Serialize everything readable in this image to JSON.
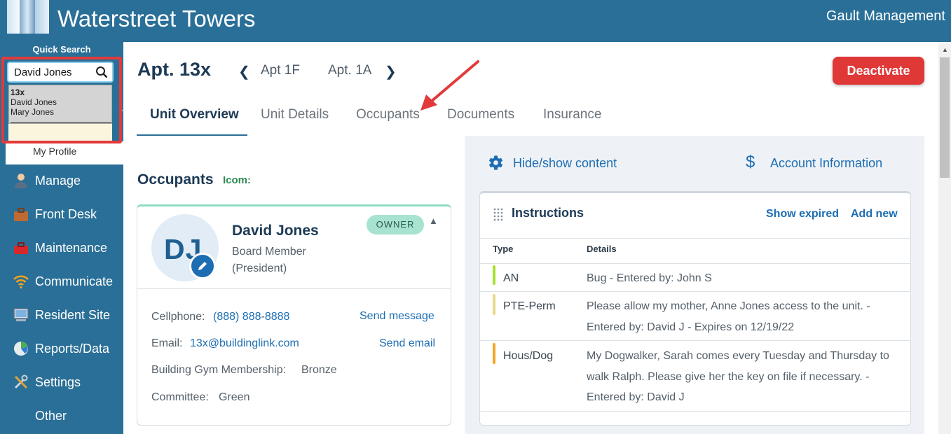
{
  "header": {
    "site_title": "Waterstreet Towers",
    "company": "Gault Management"
  },
  "quick_search": {
    "label": "Quick Search",
    "value": "David Jones",
    "results": [
      "13x",
      "David Jones",
      "Mary Jones"
    ]
  },
  "sidebar": {
    "profile_label": "My Profile",
    "items": [
      {
        "label": "Manage",
        "icon": "person-icon"
      },
      {
        "label": "Front Desk",
        "icon": "briefcase-icon"
      },
      {
        "label": "Maintenance",
        "icon": "toolbox-icon"
      },
      {
        "label": "Communicate",
        "icon": "wifi-icon"
      },
      {
        "label": "Resident Site",
        "icon": "monitor-icon"
      },
      {
        "label": "Reports/Data",
        "icon": "pie-chart-icon"
      },
      {
        "label": "Settings",
        "icon": "tools-icon"
      },
      {
        "label": "Other",
        "icon": ""
      }
    ]
  },
  "unit": {
    "title": "Apt. 13x",
    "prev_apt": "Apt 1F",
    "next_apt": "Apt. 1A",
    "deactivate_label": "Deactivate"
  },
  "tabs": [
    {
      "label": "Unit Overview",
      "active": true
    },
    {
      "label": "Unit Details",
      "active": false
    },
    {
      "label": "Occupants",
      "active": false
    },
    {
      "label": "Documents",
      "active": false
    },
    {
      "label": "Insurance",
      "active": false
    }
  ],
  "occupants": {
    "heading": "Occupants",
    "icom_label": "Icom:",
    "card": {
      "initials": "DJ",
      "name": "David Jones",
      "role": "Board Member (President)",
      "badge": "OWNER",
      "cellphone_label": "Cellphone:",
      "cellphone": "(888) 888-8888",
      "send_message": "Send message",
      "email_label": "Email:",
      "email": "13x@buildinglink.com",
      "send_email": "Send email",
      "gym_label": "Building Gym Membership:",
      "gym_value": "Bronze",
      "committee_label": "Committee:",
      "committee_value": "Green"
    }
  },
  "right_panel": {
    "hide_show": "Hide/show content",
    "account_info": "Account Information",
    "instructions": {
      "title": "Instructions",
      "show_expired": "Show expired",
      "add_new": "Add new",
      "columns": [
        "Type",
        "Details"
      ],
      "rows": [
        {
          "type": "AN",
          "color": "#a6e22e",
          "details": "Bug  - Entered by: John S"
        },
        {
          "type": "PTE-Perm",
          "color": "#e8d98a",
          "details": "Please allow my mother, Anne Jones access to the unit.  - Entered by: David J  - Expires on 12/19/22"
        },
        {
          "type": "Hous/Dog",
          "color": "#f5a623",
          "details": "My Dogwalker, Sarah comes every Tuesday and Thursday to walk Ralph. Please give her the key on file if necessary.  - Entered by: David J"
        }
      ]
    }
  },
  "colors": {
    "brand": "#2a6f97",
    "accent_link": "#1d6db3",
    "danger": "#e03737",
    "annotation": "#e23a3a"
  }
}
